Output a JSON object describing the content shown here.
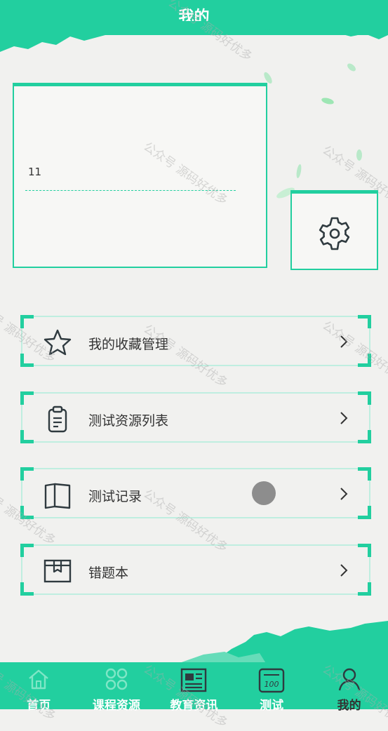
{
  "header": {
    "title": "我的"
  },
  "profile": {
    "name": "11"
  },
  "menu": [
    {
      "label": "我的收藏管理",
      "icon": "star-icon"
    },
    {
      "label": "测试资源列表",
      "icon": "clipboard-icon"
    },
    {
      "label": "测试记录",
      "icon": "book-icon"
    },
    {
      "label": "错题本",
      "icon": "box-icon"
    }
  ],
  "tabbar": {
    "items": [
      {
        "label": "首页",
        "icon": "home-icon"
      },
      {
        "label": "课程资源",
        "icon": "grid-icon"
      },
      {
        "label": "教育资讯",
        "icon": "news-icon"
      },
      {
        "label": "测试",
        "icon": "test-icon",
        "icon_text": "100"
      },
      {
        "label": "我的",
        "icon": "person-icon",
        "active": true
      }
    ]
  },
  "watermark": "公众号 源码好优多",
  "colors": {
    "accent": "#22cf9f",
    "background": "#f1f1ef"
  }
}
